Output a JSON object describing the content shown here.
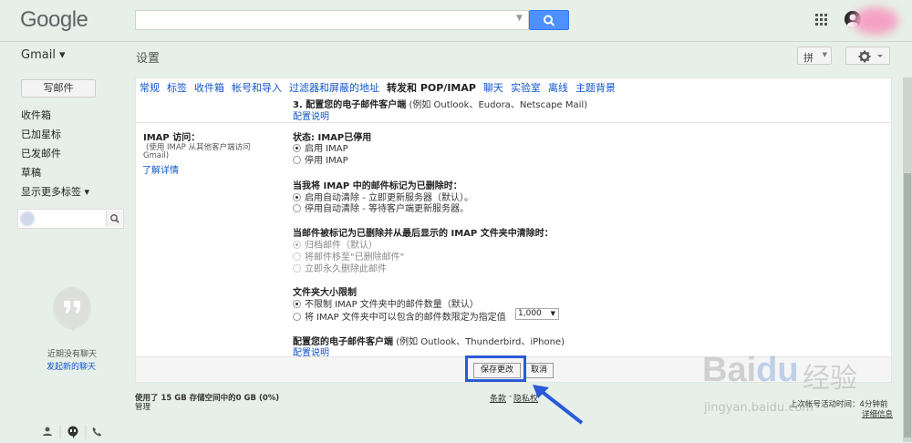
{
  "header": {
    "logo": "Google",
    "apps_icon": "apps-grid-icon",
    "search_icon": "search-icon"
  },
  "subheader": {
    "gmail_label": "Gmail ▾",
    "page_title": "设置",
    "ime_label": "拼",
    "gear_icon": "gear-icon"
  },
  "sidebar": {
    "compose": "写邮件",
    "items": [
      "收件箱",
      "已加星标",
      "已发邮件",
      "草稿",
      "显示更多标签 ▾"
    ],
    "no_chat": "近期没有聊天",
    "start_chat": "发起新的聊天"
  },
  "tabs": [
    "常规",
    "标签",
    "收件箱",
    "帐号和导入",
    "过滤器和屏蔽的地址",
    "转发和 POP/IMAP",
    "聊天",
    "实验室",
    "离线",
    "主题背景"
  ],
  "tabs_active_index": 5,
  "settings": {
    "step3_title": "3. 配置您的电子邮件客户端",
    "step3_example": "(例如 Outlook、Eudora、Netscape Mail)",
    "step3_link": "配置说明",
    "imap_label": "IMAP 访问：",
    "imap_help": "(使用 IMAP 从其他客户端访问",
    "imap_help2": "Gmail)",
    "learn_more": "了解详情",
    "status": "状态: IMAP已停用",
    "enable_imap": "启用 IMAP",
    "disable_imap": "停用 IMAP",
    "delete_title": "当我将 IMAP 中的邮件标记为已删除时：",
    "delete_opt1": "启用自动清除 - 立即更新服务器（默认）。",
    "delete_opt2": "停用自动清除 - 等待客户端更新服务器。",
    "expunge_title": "当邮件被标记为已删除并从最后显示的 IMAP 文件夹中清除时：",
    "expunge_opt1": "归档邮件（默认）",
    "expunge_opt2": "将邮件移至\"已删除邮件\"",
    "expunge_opt3": "立即永久删除此邮件",
    "folder_title": "文件夹大小限制",
    "folder_opt1": "不限制 IMAP 文件夹中的邮件数量（默认）",
    "folder_opt2": "将 IMAP 文件夹中可以包含的邮件数限定为指定值",
    "folder_limit": "1,000",
    "client_title": "配置您的电子邮件客户端",
    "client_example": "(例如 Outlook、Thunderbird、iPhone)",
    "client_link": "配置说明"
  },
  "footer": {
    "save": "保存更改",
    "cancel": "取消",
    "storage": "使用了 15 GB 存储空间中的0 GB (0%)",
    "manage": "管理",
    "terms": "条款",
    "privacy": "隐私权",
    "last_activity": "上次帐号活动时间：",
    "last_activity_value": "4分钟前",
    "details": "详细信息"
  },
  "watermark": {
    "brand": "Bai",
    "brand2": "du",
    "cn": "经验",
    "url": "jingyan.baidu.com"
  },
  "colors": {
    "background": "#e7f0e8",
    "link": "#1155cc",
    "highlight": "#2a5ad6",
    "search_button": "#4d90fe"
  }
}
